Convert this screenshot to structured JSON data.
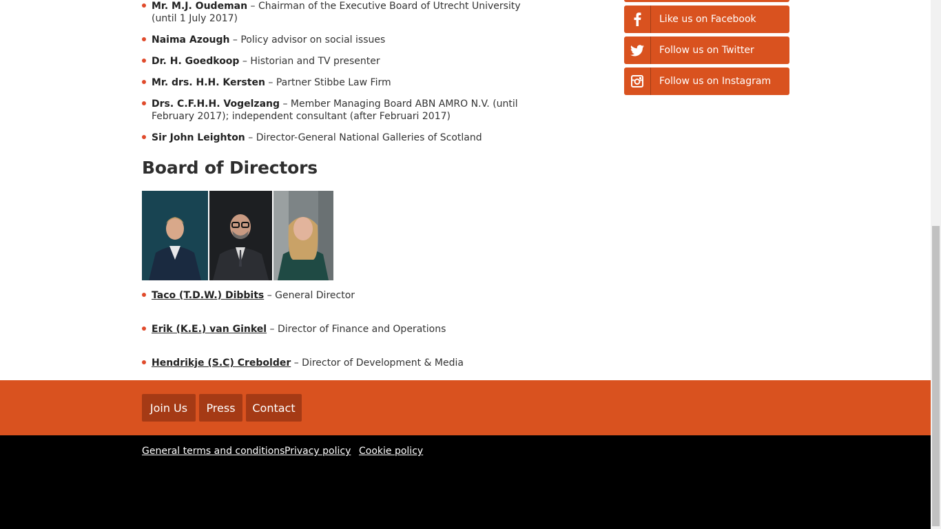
{
  "supervisory_list": [
    {
      "name": "Mr. M.J. Oudeman",
      "role": "Chairman of the Executive Board of Utrecht University (until 1 July 2017)"
    },
    {
      "name": "Naima Azough",
      "role": "Policy advisor on social issues"
    },
    {
      "name": "Dr. H. Goedkoop",
      "role": "Historian and TV presenter"
    },
    {
      "name": "Mr. drs. H.H. Kersten",
      "role": "Partner Stibbe Law Firm"
    },
    {
      "name": "Drs. C.F.H.H. Vogelzang",
      "role": "Member Managing Board ABN AMRO N.V. (until February 2017); independent consultant (after Februari 2017)"
    },
    {
      "name": "Sir John Leighton",
      "role": "Director-General National Galleries of Scotland"
    }
  ],
  "board": {
    "heading": "Board of Directors",
    "members": [
      {
        "name": "Taco (T.D.W.) Dibbits",
        "role": "General Director"
      },
      {
        "name": "Erik (K.E.) van Ginkel",
        "role": "Director of Finance and Operations"
      },
      {
        "name": "Hendrikje (S.C) Crebolder",
        "role": "Director of Development & Media"
      }
    ]
  },
  "sidebar": {
    "social": [
      {
        "label": "Like us on Facebook",
        "icon": "facebook-icon"
      },
      {
        "label": "Follow us on Twitter",
        "icon": "twitter-icon"
      },
      {
        "label": "Follow us on Instagram",
        "icon": "instagram-icon"
      }
    ]
  },
  "footer": {
    "buttons": [
      "Join Us",
      "Press",
      "Contact"
    ],
    "links": [
      "General terms and conditions ",
      "Privacy policy ",
      "Cookie policy"
    ]
  },
  "colors": {
    "accent": "#d9521f",
    "footer_button": "#a53a15",
    "bullet": "#e04a2b",
    "footer_bottom": "#000000"
  }
}
